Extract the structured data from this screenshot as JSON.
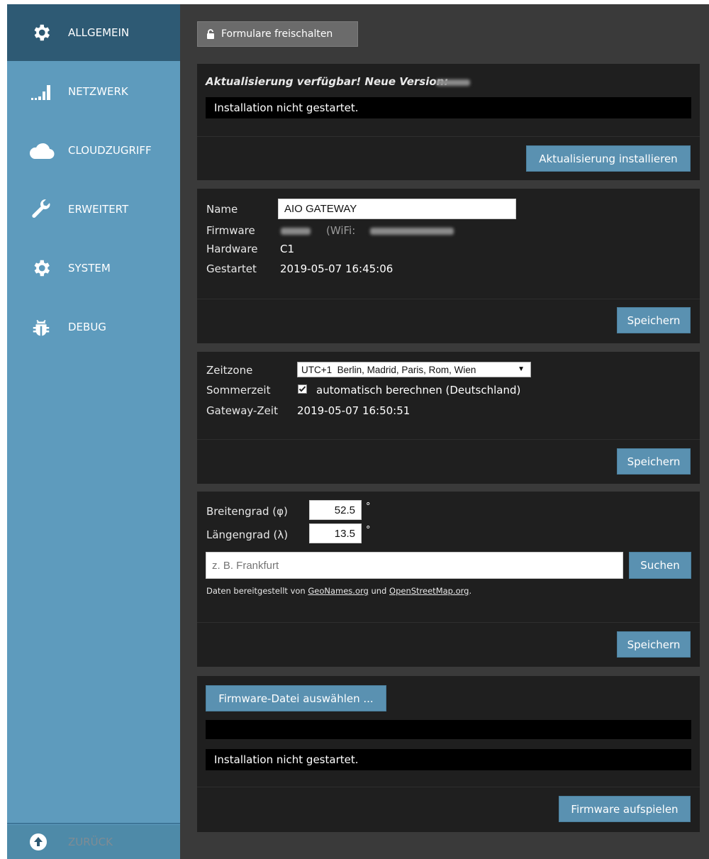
{
  "sidebar": {
    "items": [
      {
        "label": "ALLGEMEIN",
        "icon": "gear-icon",
        "active": true
      },
      {
        "label": "NETZWERK",
        "icon": "signal-bars-icon",
        "active": false
      },
      {
        "label": "CLOUDZUGRIFF",
        "icon": "cloud-icon",
        "active": false
      },
      {
        "label": "ERWEITERT",
        "icon": "wrench-icon",
        "active": false
      },
      {
        "label": "SYSTEM",
        "icon": "gear-icon",
        "active": false
      },
      {
        "label": "DEBUG",
        "icon": "bug-icon",
        "active": false
      }
    ],
    "back_label": "ZURÜCK",
    "back_icon": "arrow-up-circle-icon"
  },
  "toolbar": {
    "unlock_label": "Formulare freischalten",
    "unlock_icon": "lock-icon"
  },
  "update": {
    "heading": "Aktualisierung verfügbar! Neue Version:",
    "status": "Installation nicht gestartet.",
    "install_label": "Aktualisierung installieren"
  },
  "device": {
    "name_label": "Name",
    "name_value": "AIO GATEWAY",
    "firmware_label": "Firmware",
    "wifi_prefix": "(WiFi:",
    "hardware_label": "Hardware",
    "hardware_value": "C1",
    "started_label": "Gestartet",
    "started_value": "2019-05-07 16:45:06",
    "save_label": "Speichern"
  },
  "time": {
    "timezone_label": "Zeitzone",
    "timezone_value": "UTC+1  Berlin, Madrid, Paris, Rom, Wien",
    "dst_label": "Sommerzeit",
    "dst_checked": true,
    "dst_text": "automatisch berechnen (Deutschland)",
    "gateway_time_label": "Gateway-Zeit",
    "gateway_time_value": "2019-05-07 16:50:51",
    "save_label": "Speichern"
  },
  "location": {
    "lat_label": "Breitengrad (φ)",
    "lat_value": "52.5",
    "lon_label": "Längengrad (λ)",
    "lon_value": "13.5",
    "degree": "°",
    "search_placeholder": "z. B. Frankfurt",
    "search_label": "Suchen",
    "credit_prefix": "Daten bereitgestellt von",
    "credit_link1": "GeoNames.org",
    "credit_and": "und",
    "credit_link2": "OpenStreetMap.org",
    "credit_suffix": ".",
    "save_label": "Speichern"
  },
  "firmware_upload": {
    "select_label": "Firmware-Datei auswählen ...",
    "status": "Installation nicht gestartet.",
    "flash_label": "Firmware aufspielen"
  },
  "colors": {
    "sidebar": "#5e9bbd",
    "sidebar_active": "#2e5a74",
    "button": "#5a91b1",
    "panel": "#1f1f1f",
    "background": "#3a3a3a"
  }
}
